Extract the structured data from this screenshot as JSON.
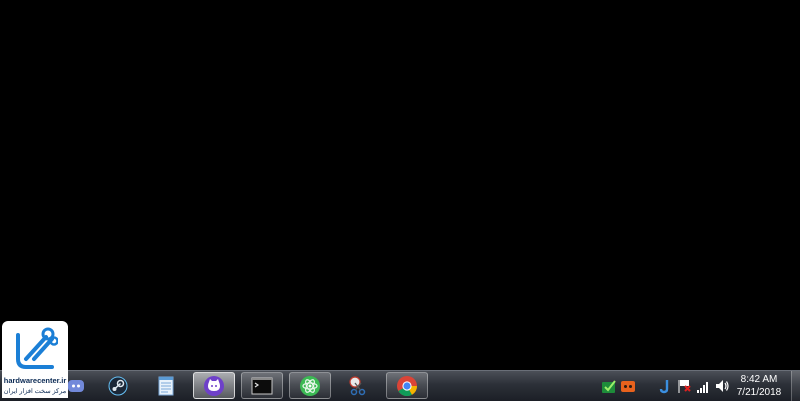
{
  "watermark": {
    "site": "hardwarecenter.ir",
    "tagline": "مرکز سخت افزار ایران"
  },
  "taskbar": {
    "apps": [
      {
        "name": "discord",
        "icon": "discord-icon",
        "open": false
      },
      {
        "name": "steam",
        "icon": "steam-icon",
        "open": false
      },
      {
        "name": "notepad",
        "icon": "notepad-icon",
        "open": false
      },
      {
        "name": "github-desktop",
        "icon": "github-cat-icon",
        "open": true,
        "active": true
      },
      {
        "name": "terminal",
        "icon": "terminal-icon",
        "open": true
      },
      {
        "name": "atom",
        "icon": "atom-icon",
        "open": true
      },
      {
        "name": "snipping-tool",
        "icon": "scissors-icon",
        "open": false
      },
      {
        "name": "chrome",
        "icon": "chrome-icon",
        "open": true
      }
    ]
  },
  "tray": {
    "icons": [
      "check-icon",
      "game-icon",
      "j-icon",
      "flag-icon",
      "signal-icon",
      "volume-icon"
    ],
    "time": "8:42 AM",
    "date": "7/21/2018"
  }
}
